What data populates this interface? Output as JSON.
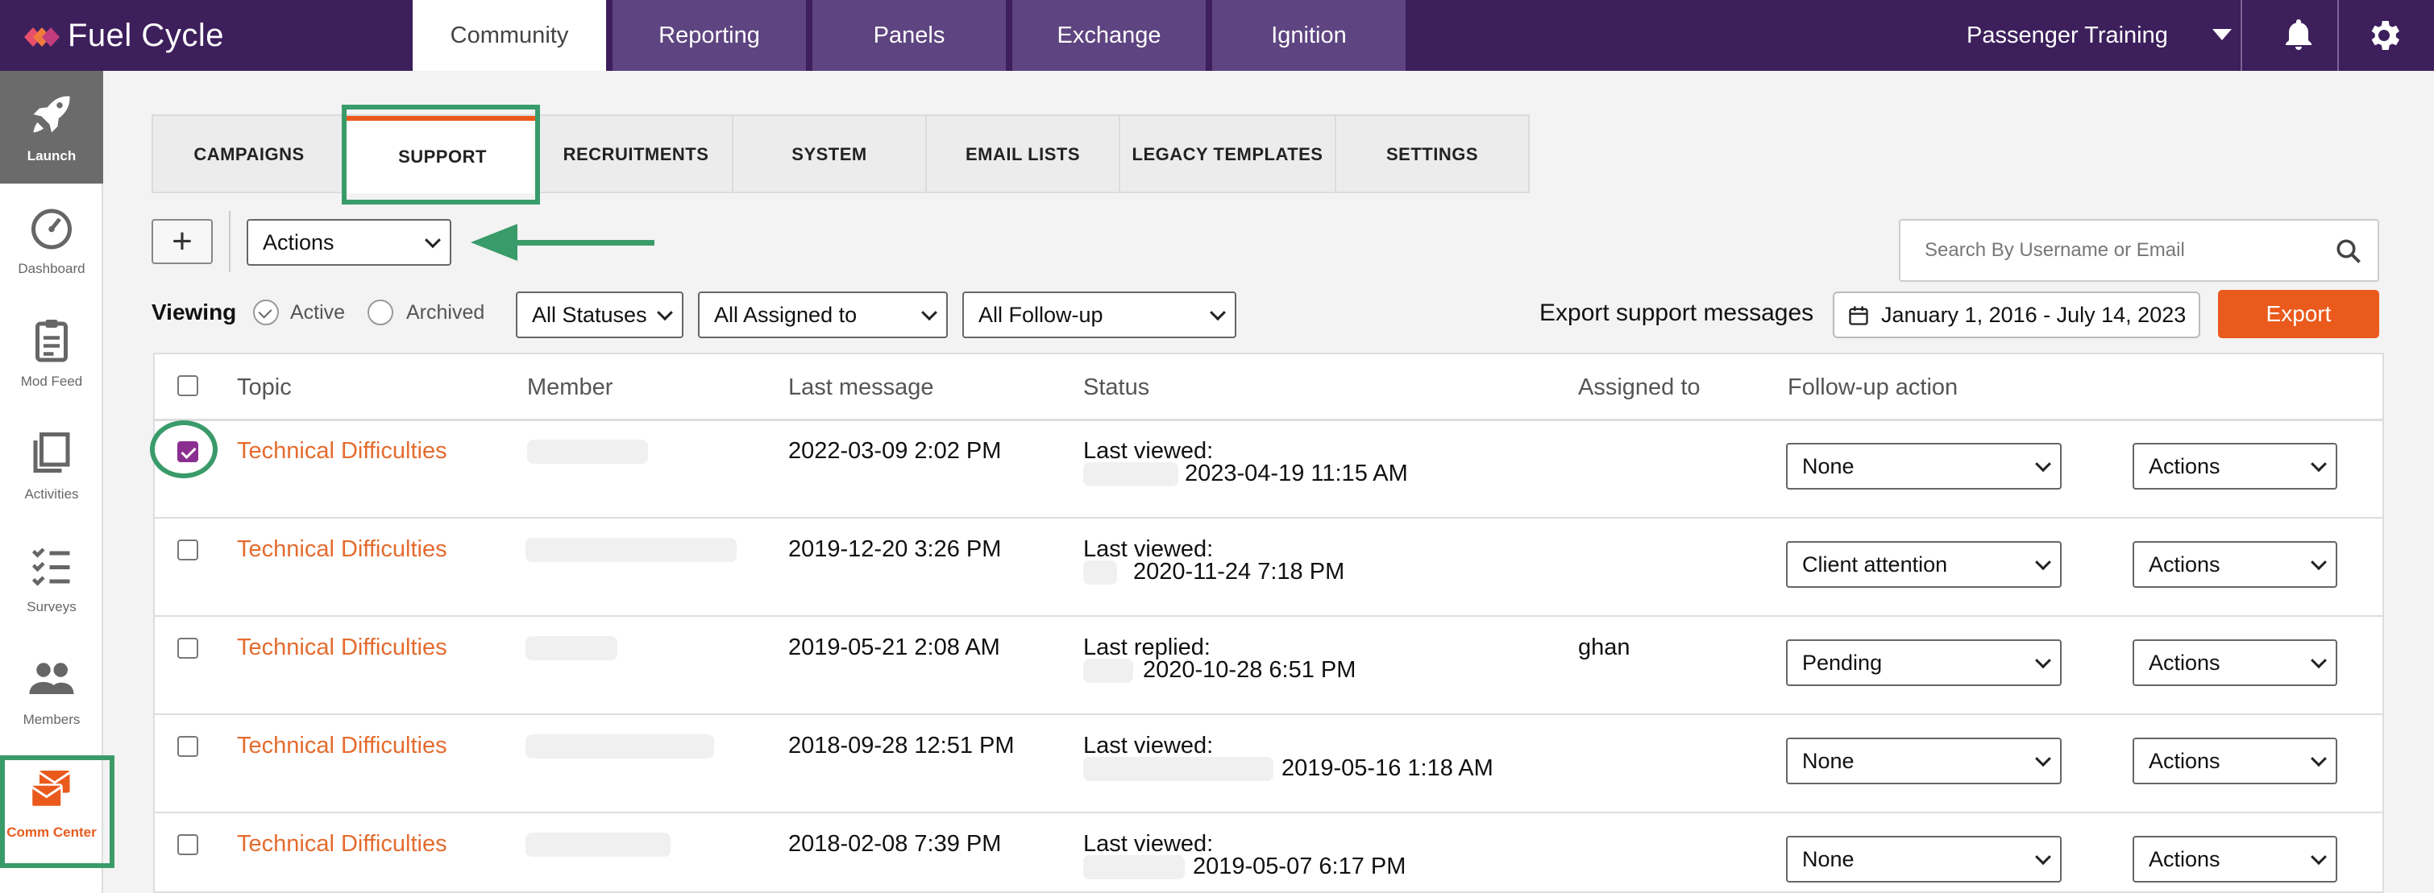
{
  "app": {
    "logo_text": "Fuel Cycle"
  },
  "top_nav": {
    "tabs": [
      {
        "label": "Community"
      },
      {
        "label": "Reporting"
      },
      {
        "label": "Panels"
      },
      {
        "label": "Exchange"
      },
      {
        "label": "Ignition"
      }
    ],
    "active_tab": "Community",
    "project": "Passenger Training",
    "icons": [
      "bell-icon",
      "gear-icon"
    ]
  },
  "sidebar": {
    "items": [
      {
        "label": "Launch",
        "icon": "rocket-icon"
      },
      {
        "label": "Dashboard",
        "icon": "gauge-icon"
      },
      {
        "label": "Mod Feed",
        "icon": "clipboard-icon"
      },
      {
        "label": "Activities",
        "icon": "stack-icon"
      },
      {
        "label": "Surveys",
        "icon": "checklist-icon"
      },
      {
        "label": "Members",
        "icon": "people-icon"
      },
      {
        "label": "Comm Center",
        "icon": "envelopes-icon"
      }
    ],
    "active": "Comm Center"
  },
  "sub_tabs": {
    "items": [
      {
        "label": "CAMPAIGNS"
      },
      {
        "label": "SUPPORT"
      },
      {
        "label": "RECRUITMENTS"
      },
      {
        "label": "SYSTEM"
      },
      {
        "label": "EMAIL LISTS"
      },
      {
        "label": "LEGACY TEMPLATES"
      },
      {
        "label": "SETTINGS"
      }
    ],
    "active": "SUPPORT"
  },
  "toolbar": {
    "add_label": "+",
    "actions_select": "Actions",
    "search_placeholder": "Search By Username or Email"
  },
  "filters": {
    "viewing_label": "Viewing",
    "active_label": "Active",
    "archived_label": "Archived",
    "selected_view": "Active",
    "status_select": "All Statuses",
    "assigned_select": "All Assigned to",
    "followup_select": "All Follow-up"
  },
  "export": {
    "label": "Export support messages",
    "date_range": "January 1, 2016 - July 14, 2023",
    "button": "Export"
  },
  "table": {
    "columns": [
      "Topic",
      "Member",
      "Last message",
      "Status",
      "Assigned to",
      "Follow-up action"
    ],
    "rows": [
      {
        "checked": true,
        "topic": "Technical Difficulties",
        "last_message": "2022-03-09 2:02 PM",
        "status_line1": "Last viewed:",
        "status_line2": "2023-04-19 11:15 AM",
        "assigned": "",
        "followup": "None",
        "actions": "Actions"
      },
      {
        "checked": false,
        "topic": "Technical Difficulties",
        "last_message": "2019-12-20 3:26 PM",
        "status_line1": "Last viewed:",
        "status_line2": "2020-11-24 7:18 PM",
        "assigned": "",
        "followup": "Client attention",
        "actions": "Actions"
      },
      {
        "checked": false,
        "topic": "Technical Difficulties",
        "last_message": "2019-05-21 2:08 AM",
        "status_line1": "Last replied:",
        "status_line2": "2020-10-28 6:51 PM",
        "assigned": "ghan",
        "followup": "Pending",
        "actions": "Actions"
      },
      {
        "checked": false,
        "topic": "Technical Difficulties",
        "last_message": "2018-09-28 12:51 PM",
        "status_line1": "Last viewed:",
        "status_line2": "2019-05-16 1:18 AM",
        "assigned": "",
        "followup": "None",
        "actions": "Actions"
      },
      {
        "checked": false,
        "topic": "Technical Difficulties",
        "last_message": "2018-02-08 7:39 PM",
        "status_line1": "Last viewed:",
        "status_line2": "2019-05-07 6:17 PM",
        "assigned": "",
        "followup": "None",
        "actions": "Actions"
      }
    ]
  },
  "colors": {
    "brand_purple": "#3d1f5c",
    "accent_orange": "#ea5a1c",
    "annotation_green": "#3a9b6a"
  }
}
